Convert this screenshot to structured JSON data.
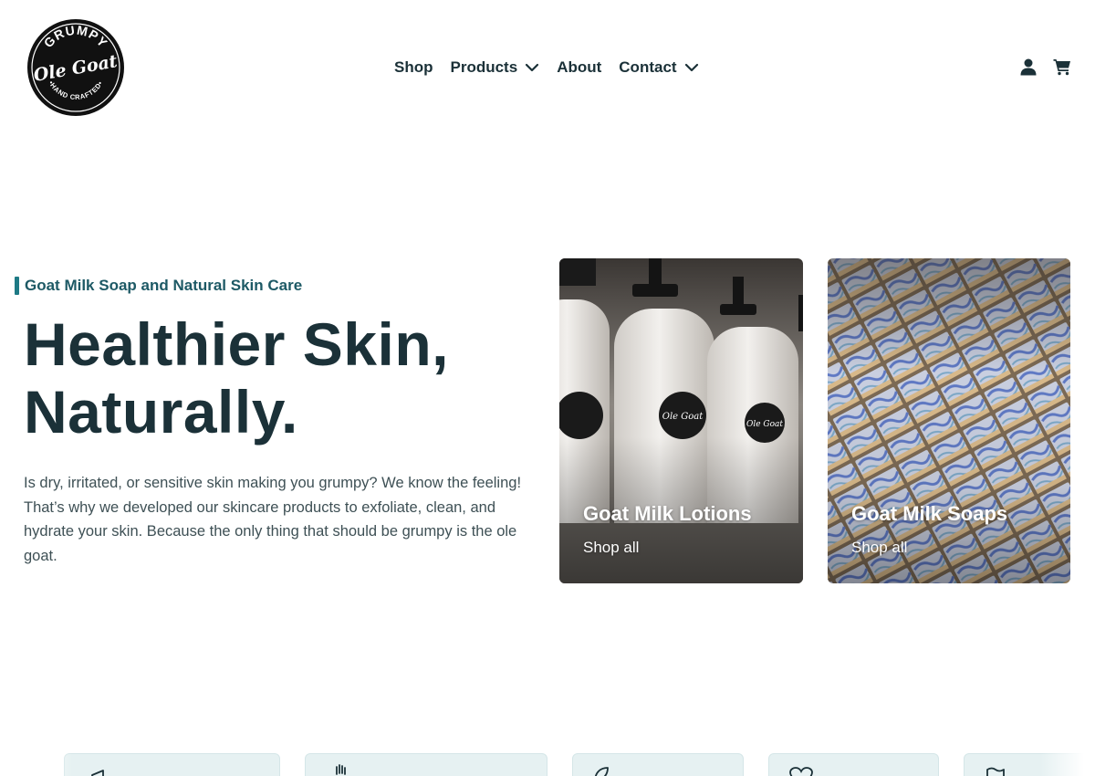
{
  "brand": {
    "logo_top": "GRUMPY",
    "logo_main": "Ole Goat",
    "logo_bottom": "HAND CRAFTED"
  },
  "nav": {
    "items": [
      {
        "label": "Shop",
        "has_dropdown": false
      },
      {
        "label": "Products",
        "has_dropdown": true
      },
      {
        "label": "About",
        "has_dropdown": false
      },
      {
        "label": "Contact",
        "has_dropdown": true
      }
    ]
  },
  "header_icons": [
    "account-icon",
    "cart-icon"
  ],
  "hero": {
    "eyebrow": "Goat Milk Soap and Natural Skin Care",
    "title_line1": "Healthier Skin,",
    "title_line2": "Naturally.",
    "body": "Is dry, irritated, or sensitive skin making you grumpy? We know the feeling! That’s why we developed our skincare products to exfoliate, clean, and hydrate your skin. Because the only thing that should be grumpy is the ole goat."
  },
  "cards": [
    {
      "title": "Goat Milk Lotions",
      "link": "Shop all"
    },
    {
      "title": "Goat Milk Soaps",
      "link": "Shop all"
    }
  ],
  "features": [
    {
      "icon": "megaphone-icon",
      "label": ""
    },
    {
      "icon": "hand-icon",
      "label": ""
    },
    {
      "icon": "leaf-icon",
      "label": ""
    },
    {
      "icon": "heart-icon",
      "label": ""
    },
    {
      "icon": "flag-icon",
      "label": ""
    }
  ],
  "colors": {
    "text_dark": "#1b3138",
    "accent_teal": "#1e7a85",
    "eyebrow_text": "#1d5965",
    "body_text": "#3e5055",
    "feature_bg": "#e6f1f2"
  }
}
